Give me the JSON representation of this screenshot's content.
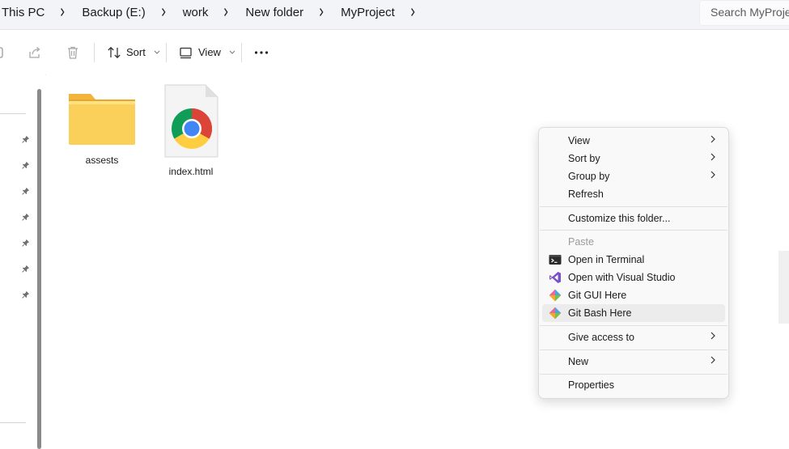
{
  "breadcrumb": [
    "This PC",
    "Backup (E:)",
    "work",
    "New folder",
    "MyProject"
  ],
  "search": {
    "placeholder": "Search MyProject"
  },
  "toolbar": {
    "sort_label": "Sort",
    "view_label": "View"
  },
  "files": [
    {
      "name": "assests",
      "icon": "folder-icon"
    },
    {
      "name": "index.html",
      "icon": "chrome-file-icon"
    }
  ],
  "context_menu": {
    "items": [
      {
        "label": "View",
        "submenu": true
      },
      {
        "label": "Sort by",
        "submenu": true
      },
      {
        "label": "Group by",
        "submenu": true
      },
      {
        "label": "Refresh"
      },
      {
        "label": "Customize this folder..."
      },
      {
        "label": "Paste",
        "disabled": true
      },
      {
        "label": "Open in Terminal",
        "icon": "terminal-icon"
      },
      {
        "label": "Open with Visual Studio",
        "icon": "visual-studio-icon"
      },
      {
        "label": "Git GUI Here",
        "icon": "git-icon"
      },
      {
        "label": "Git Bash Here",
        "icon": "git-icon",
        "highlighted": true
      },
      {
        "label": "Give access to",
        "submenu": true
      },
      {
        "label": "New",
        "submenu": true
      },
      {
        "label": "Properties"
      }
    ]
  },
  "colors": {
    "folder": "#f8c93c",
    "menu_background": "#f9f9f9",
    "highlight": "#ececec",
    "visual_studio": "#7b4fc9"
  }
}
